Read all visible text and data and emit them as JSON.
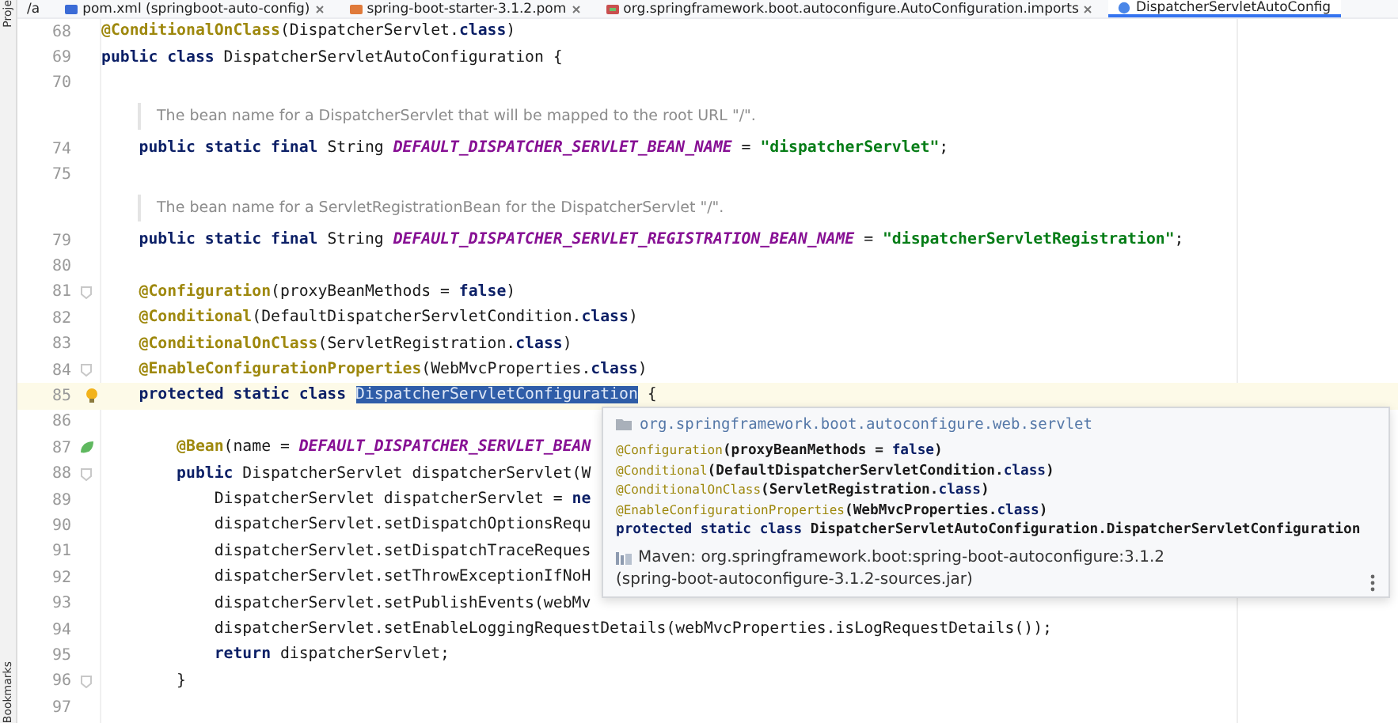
{
  "tabs": [
    {
      "label": "/a",
      "kind": "partial",
      "selected": false
    },
    {
      "label": "pom.xml (springboot-auto-config)",
      "kind": "maven",
      "selected": false
    },
    {
      "label": "spring-boot-starter-3.1.2.pom",
      "kind": "pom",
      "selected": false
    },
    {
      "label": "org.springframework.boot.autoconfigure.AutoConfiguration.imports",
      "kind": "imports",
      "selected": false
    },
    {
      "label": "DispatcherServletAutoConfig",
      "kind": "class",
      "selected": true
    }
  ],
  "tool_windows": [
    {
      "label": "Proje"
    },
    {
      "label": "Bookmarks"
    }
  ],
  "editor": {
    "lines": [
      {
        "kind": "code",
        "number": "68",
        "current": false,
        "tokens": [
          {
            "kind": "annotation",
            "text": "@ConditionalOnClass"
          },
          {
            "kind": "plain",
            "text": "(DispatcherServlet."
          },
          {
            "kind": "keyword",
            "text": "class"
          },
          {
            "kind": "plain",
            "text": ")"
          }
        ]
      },
      {
        "kind": "code",
        "number": "69",
        "current": false,
        "tokens": [
          {
            "kind": "keyword",
            "text": "public class"
          },
          {
            "kind": "plain",
            "text": " DispatcherServletAutoConfiguration {"
          }
        ]
      },
      {
        "kind": "code",
        "number": "70",
        "current": false
      },
      {
        "kind": "doc",
        "text": "The bean name for a DispatcherServlet that will be mapped to the root URL \"/\"."
      },
      {
        "kind": "code",
        "number": "74",
        "current": false,
        "tokens": [
          {
            "kind": "keyword",
            "text": "    public static final"
          },
          {
            "kind": "plain",
            "text": " String "
          },
          {
            "kind": "constant",
            "text": "DEFAULT_DISPATCHER_SERVLET_BEAN_NAME"
          },
          {
            "kind": "plain",
            "text": " = "
          },
          {
            "kind": "string",
            "text": "\"dispatcherServlet\""
          },
          {
            "kind": "plain",
            "text": ";"
          }
        ]
      },
      {
        "kind": "code",
        "number": "75",
        "current": false
      },
      {
        "kind": "doc",
        "text": "The bean name for a ServletRegistrationBean for the DispatcherServlet \"/\"."
      },
      {
        "kind": "code",
        "number": "79",
        "current": false,
        "tokens": [
          {
            "kind": "keyword",
            "text": "    public static final"
          },
          {
            "kind": "plain",
            "text": " String "
          },
          {
            "kind": "constant",
            "text": "DEFAULT_DISPATCHER_SERVLET_REGISTRATION_BEAN_NAME"
          },
          {
            "kind": "plain",
            "text": " = "
          },
          {
            "kind": "string",
            "text": "\"dispatcherServletRegistration\""
          },
          {
            "kind": "plain",
            "text": ";"
          }
        ]
      },
      {
        "kind": "code",
        "number": "80",
        "current": false
      },
      {
        "kind": "code",
        "number": "81",
        "current": false,
        "gutter": {
          "kind": "fold"
        },
        "tokens": [
          {
            "kind": "annotation",
            "text": "    @Configuration"
          },
          {
            "kind": "plain",
            "text": "(proxyBeanMethods = "
          },
          {
            "kind": "keyword",
            "text": "false"
          },
          {
            "kind": "plain",
            "text": ")"
          }
        ]
      },
      {
        "kind": "code",
        "number": "82",
        "current": false,
        "tokens": [
          {
            "kind": "annotation",
            "text": "    @Conditional"
          },
          {
            "kind": "plain",
            "text": "(DefaultDispatcherServletCondition."
          },
          {
            "kind": "keyword",
            "text": "class"
          },
          {
            "kind": "plain",
            "text": ")"
          }
        ]
      },
      {
        "kind": "code",
        "number": "83",
        "current": false,
        "tokens": [
          {
            "kind": "annotation",
            "text": "    @ConditionalOnClass"
          },
          {
            "kind": "plain",
            "text": "(ServletRegistration."
          },
          {
            "kind": "keyword",
            "text": "class"
          },
          {
            "kind": "plain",
            "text": ")"
          }
        ]
      },
      {
        "kind": "code",
        "number": "84",
        "current": false,
        "gutter": {
          "kind": "fold"
        },
        "tokens": [
          {
            "kind": "annotation",
            "text": "    @EnableConfigurationProperties"
          },
          {
            "kind": "plain",
            "text": "(WebMvcProperties."
          },
          {
            "kind": "keyword",
            "text": "class"
          },
          {
            "kind": "plain",
            "text": ")"
          }
        ]
      },
      {
        "kind": "code",
        "number": "85",
        "current": true,
        "gutter": {
          "kind": "lightbulb"
        },
        "tokens": [
          {
            "kind": "keyword",
            "text": "    protected static class "
          },
          {
            "kind": "selection",
            "text": "DispatcherServletConfiguration"
          },
          {
            "kind": "plain",
            "text": " {"
          }
        ]
      },
      {
        "kind": "code",
        "number": "86",
        "current": false
      },
      {
        "kind": "code",
        "number": "87",
        "current": false,
        "gutter": {
          "kind": "bean"
        },
        "tokens": [
          {
            "kind": "annotation",
            "text": "        @Bean"
          },
          {
            "kind": "plain",
            "text": "(name = "
          },
          {
            "kind": "constant",
            "text": "DEFAULT_DISPATCHER_SERVLET_BEAN"
          }
        ]
      },
      {
        "kind": "code",
        "number": "88",
        "current": false,
        "gutter": {
          "kind": "fold"
        },
        "tokens": [
          {
            "kind": "keyword",
            "text": "        public"
          },
          {
            "kind": "plain",
            "text": " DispatcherServlet dispatcherServlet(W"
          }
        ]
      },
      {
        "kind": "code",
        "number": "89",
        "current": false,
        "tokens": [
          {
            "kind": "plain",
            "text": "            DispatcherServlet dispatcherServlet = "
          },
          {
            "kind": "keyword",
            "text": "ne"
          }
        ]
      },
      {
        "kind": "code",
        "number": "90",
        "current": false,
        "tokens": [
          {
            "kind": "plain",
            "text": "            dispatcherServlet.setDispatchOptionsRequ"
          }
        ]
      },
      {
        "kind": "code",
        "number": "91",
        "current": false,
        "tokens": [
          {
            "kind": "plain",
            "text": "            dispatcherServlet.setDispatchTraceReques"
          }
        ]
      },
      {
        "kind": "code",
        "number": "92",
        "current": false,
        "tokens": [
          {
            "kind": "plain",
            "text": "            dispatcherServlet.setThrowExceptionIfNoH"
          }
        ]
      },
      {
        "kind": "code",
        "number": "93",
        "current": false,
        "tokens": [
          {
            "kind": "plain",
            "text": "            dispatcherServlet.setPublishEvents(webMv"
          }
        ]
      },
      {
        "kind": "code",
        "number": "94",
        "current": false,
        "tokens": [
          {
            "kind": "plain",
            "text": "            dispatcherServlet.setEnableLoggingRequestDetails(webMvcProperties.isLogRequestDetails());"
          }
        ]
      },
      {
        "kind": "code",
        "number": "95",
        "current": false,
        "tokens": [
          {
            "kind": "keyword",
            "text": "            return"
          },
          {
            "kind": "plain",
            "text": " dispatcherServlet;"
          }
        ]
      },
      {
        "kind": "code",
        "number": "96",
        "current": false,
        "gutter": {
          "kind": "fold"
        },
        "tokens": [
          {
            "kind": "plain",
            "text": "        }"
          }
        ]
      },
      {
        "kind": "code",
        "number": "97",
        "current": false
      }
    ]
  },
  "popup": {
    "package": "org.springframework.boot.autoconfigure.web.servlet",
    "lines": [
      [
        {
          "kind": "annotation",
          "text": "@Configuration"
        },
        {
          "kind": "plain",
          "text": "(proxyBeanMethods = "
        },
        {
          "kind": "keyword",
          "text": "false"
        },
        {
          "kind": "plain",
          "text": ")"
        }
      ],
      [
        {
          "kind": "annotation",
          "text": "@Conditional"
        },
        {
          "kind": "plain",
          "text": "(DefaultDispatcherServletCondition."
        },
        {
          "kind": "keyword",
          "text": "class"
        },
        {
          "kind": "plain",
          "text": ")"
        }
      ],
      [
        {
          "kind": "annotation",
          "text": "@ConditionalOnClass"
        },
        {
          "kind": "plain",
          "text": "(ServletRegistration."
        },
        {
          "kind": "keyword",
          "text": "class"
        },
        {
          "kind": "plain",
          "text": ")"
        }
      ],
      [
        {
          "kind": "annotation",
          "text": "@EnableConfigurationProperties"
        },
        {
          "kind": "plain",
          "text": "(WebMvcProperties."
        },
        {
          "kind": "keyword",
          "text": "class"
        },
        {
          "kind": "plain",
          "text": ")"
        }
      ],
      [
        {
          "kind": "keyword",
          "text": "protected static class"
        },
        {
          "kind": "plain",
          "text": " DispatcherServletAutoConfiguration.DispatcherServletConfiguration"
        }
      ]
    ],
    "source": [
      "Maven: org.springframework.boot:spring-boot-autoconfigure:3.1.2",
      "(spring-boot-autoconfigure-3.1.2-sources.jar)"
    ]
  }
}
